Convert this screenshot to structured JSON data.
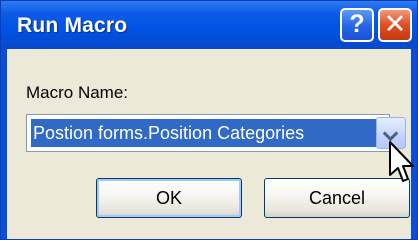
{
  "window": {
    "title": "Run Macro",
    "help_glyph": "?",
    "close_glyph": "✕"
  },
  "form": {
    "macro_name_label": "Macro Name:",
    "macro_name_value": "Postion forms.Position Categories"
  },
  "buttons": {
    "ok_label": "OK",
    "cancel_label": "Cancel"
  },
  "icons": {
    "help": "help-icon",
    "close": "close-icon",
    "dropdown": "chevron-down-icon",
    "cursor": "mouse-cursor-icon"
  },
  "colors": {
    "titlebar": "#0052e4",
    "client": "#ece9d8",
    "selection": "#316ac5",
    "close_button": "#e04f24"
  }
}
